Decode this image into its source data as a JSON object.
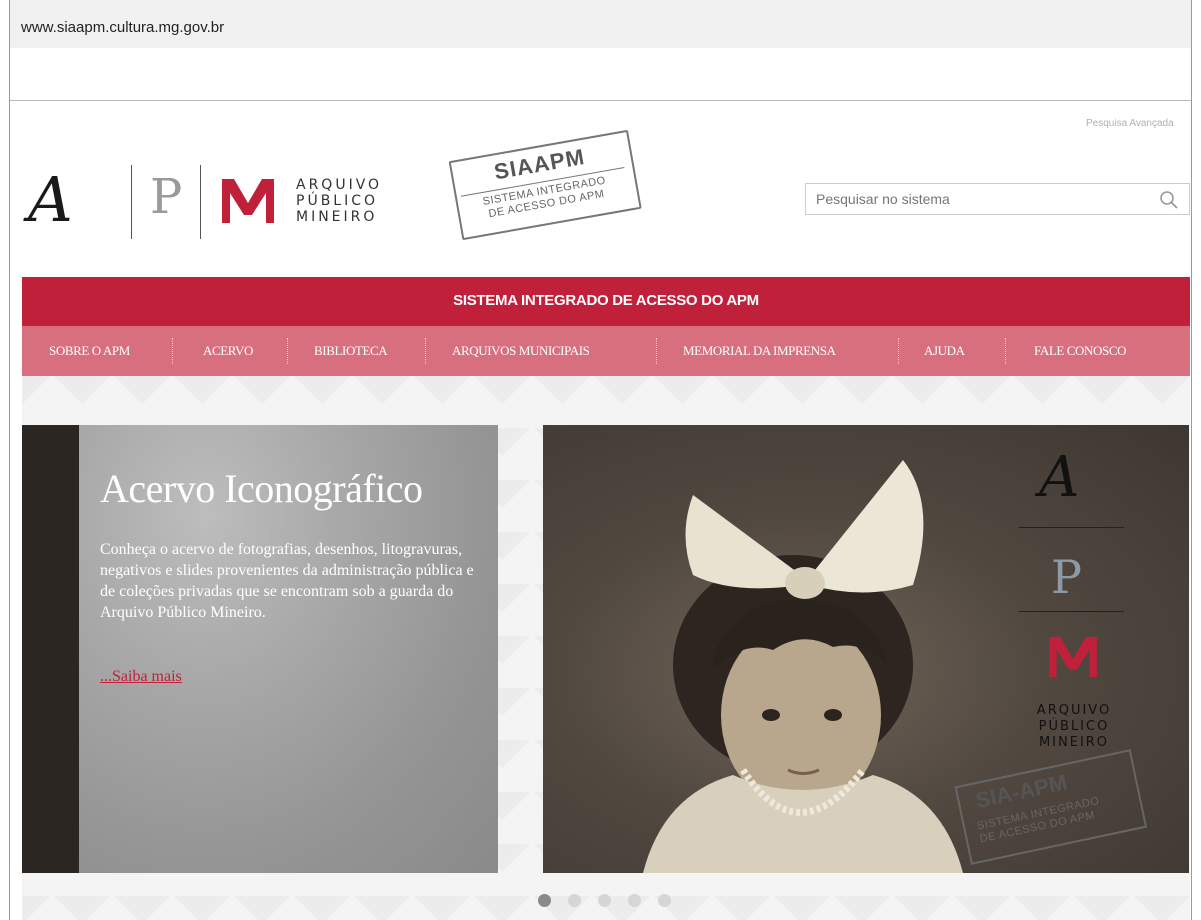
{
  "browser": {
    "url": "www.siaapm.cultura.mg.gov.br"
  },
  "header": {
    "logo_letters": [
      "A",
      "P"
    ],
    "logo_text_lines": [
      "ARQUIVO",
      "PÚBLICO",
      "MINEIRO"
    ],
    "stamp": {
      "title": "SIAAPM",
      "subtitle_line1": "SISTEMA INTEGRADO",
      "subtitle_line2": "DE ACESSO DO APM"
    },
    "search": {
      "placeholder": "Pesquisar no sistema",
      "icon": "search-icon",
      "advanced_link": "Pesquisa Avançada"
    }
  },
  "banner": {
    "title": "SISTEMA INTEGRADO DE ACESSO DO APM",
    "color": "#c1203a"
  },
  "nav": {
    "color": "#d86f7f",
    "items": [
      {
        "label": "SOBRE O APM"
      },
      {
        "label": "ACERVO"
      },
      {
        "label": "BIBLIOTECA"
      },
      {
        "label": "ARQUIVOS MUNICIPAIS"
      },
      {
        "label": "MEMORIAL DA IMPRENSA"
      },
      {
        "label": "AJUDA"
      },
      {
        "label": "FALE CONOSCO"
      }
    ]
  },
  "slide": {
    "title": "Acervo Iconográfico",
    "description": "Conheça o acervo de fotografias, desenhos, litogravuras, negativos e slides provenientes da administração pública e de coleções privadas que se encontram sob a guarda do Arquivo Público Mineiro.",
    "more_link": "...Saiba mais",
    "photo_logo": {
      "letters": [
        "A",
        "P"
      ],
      "text_lines": [
        "ARQUIVO",
        "PÚBLICO",
        "MINEIRO"
      ],
      "stamp_title": "SIA-APM",
      "stamp_line1": "SISTEMA INTEGRADO",
      "stamp_line2": "DE ACESSO DO APM"
    }
  },
  "carousel": {
    "dot_count": 5,
    "active_index": 0
  }
}
